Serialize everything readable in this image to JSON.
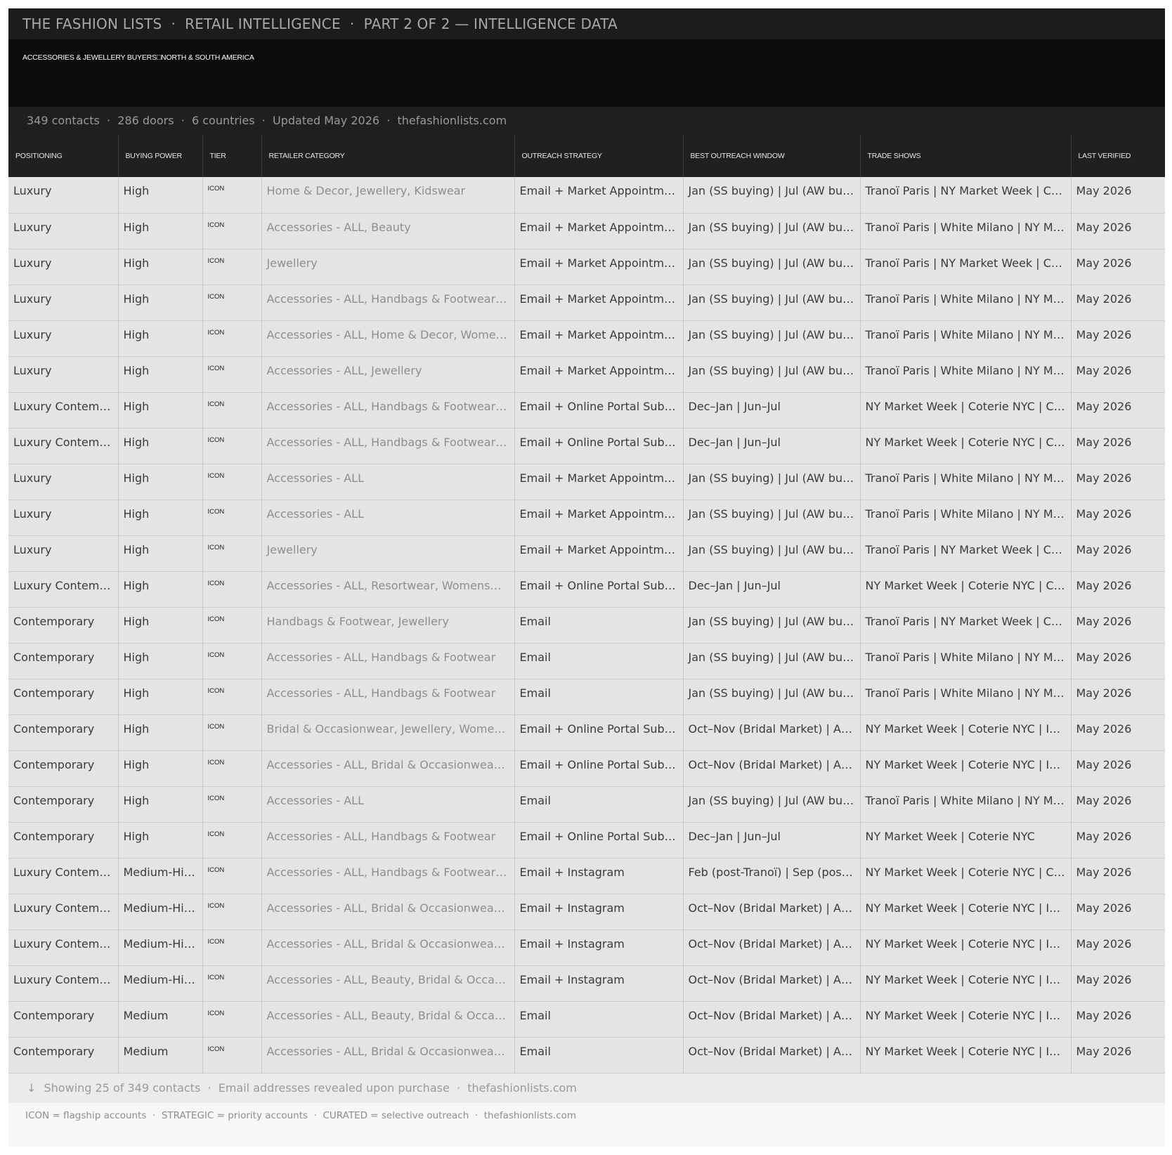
{
  "header": {
    "title": "THE FASHION LISTS  ·  RETAIL INTELLIGENCE  ·  PART 2 OF 2 — INTELLIGENCE DATA",
    "subtitle": "ACCESSORIES & JEWELLERY BUYERS□NORTH & SOUTH AMERICA",
    "stats": "349 contacts  ·  286 doors  ·  6 countries  ·  Updated May 2026  ·  thefashionlists.com"
  },
  "table": {
    "columns": [
      "POSITIONING",
      "BUYING POWER",
      "TIER",
      "RETAILER CATEGORY",
      "OUTREACH STRATEGY",
      "BEST OUTREACH WINDOW",
      "TRADE SHOWS",
      "LAST VERIFIED"
    ],
    "rows": [
      [
        "Luxury",
        "High",
        "ICON",
        "Home & Decor, Jewellery, Kidswear",
        "Email + Market Appointment",
        "Jan (SS buying) | Jul (AW buying)",
        "Tranoï Paris | NY Market Week | Coterie NYC",
        "May 2026"
      ],
      [
        "Luxury",
        "High",
        "ICON",
        "Accessories - ALL, Beauty",
        "Email + Market Appointment",
        "Jan (SS buying) | Jul (AW buying)",
        "Tranoï Paris | White Milano | NY Market Week",
        "May 2026"
      ],
      [
        "Luxury",
        "High",
        "ICON",
        "Jewellery",
        "Email + Market Appointment",
        "Jan (SS buying) | Jul (AW buying)",
        "Tranoï Paris | NY Market Week | Coterie NYC",
        "May 2026"
      ],
      [
        "Luxury",
        "High",
        "ICON",
        "Accessories - ALL, Handbags & Footwear, Jewellery",
        "Email + Market Appointment",
        "Jan (SS buying) | Jul (AW buying)",
        "Tranoï Paris | White Milano | NY Market Week",
        "May 2026"
      ],
      [
        "Luxury",
        "High",
        "ICON",
        "Accessories - ALL, Home & Decor, Womenswear",
        "Email + Market Appointment",
        "Jan (SS buying) | Jul (AW buying)",
        "Tranoï Paris | White Milano | NY Market Week",
        "May 2026"
      ],
      [
        "Luxury",
        "High",
        "ICON",
        "Accessories - ALL, Jewellery",
        "Email + Market Appointment",
        "Jan (SS buying) | Jul (AW buying)",
        "Tranoï Paris | White Milano | NY Market Week",
        "May 2026"
      ],
      [
        "Luxury Contemporary",
        "High",
        "ICON",
        "Accessories - ALL, Handbags & Footwear, Jewellery",
        "Email + Online Portal Submission",
        "Dec–Jan | Jun–Jul",
        "NY Market Week | Coterie NYC | Capsule",
        "May 2026"
      ],
      [
        "Luxury Contemporary",
        "High",
        "ICON",
        "Accessories - ALL, Handbags & Footwear, Jewellery",
        "Email + Online Portal Submission",
        "Dec–Jan | Jun–Jul",
        "NY Market Week | Coterie NYC | Capsule",
        "May 2026"
      ],
      [
        "Luxury",
        "High",
        "ICON",
        "Accessories - ALL",
        "Email + Market Appointment",
        "Jan (SS buying) | Jul (AW buying)",
        "Tranoï Paris | White Milano | NY Market Week",
        "May 2026"
      ],
      [
        "Luxury",
        "High",
        "ICON",
        "Accessories - ALL",
        "Email + Market Appointment",
        "Jan (SS buying) | Jul (AW buying)",
        "Tranoï Paris | White Milano | NY Market Week",
        "May 2026"
      ],
      [
        "Luxury",
        "High",
        "ICON",
        "Jewellery",
        "Email + Market Appointment",
        "Jan (SS buying) | Jul (AW buying)",
        "Tranoï Paris | NY Market Week | Coterie NYC",
        "May 2026"
      ],
      [
        "Luxury Contemporary",
        "High",
        "ICON",
        "Accessories - ALL, Resortwear, Womenswear",
        "Email + Online Portal Submission",
        "Dec–Jan | Jun–Jul",
        "NY Market Week | Coterie NYC | Capsule",
        "May 2026"
      ],
      [
        "Contemporary",
        "High",
        "ICON",
        "Handbags & Footwear, Jewellery",
        "Email",
        "Jan (SS buying) | Jul (AW buying)",
        "Tranoï Paris | NY Market Week | Coterie NYC",
        "May 2026"
      ],
      [
        "Contemporary",
        "High",
        "ICON",
        "Accessories - ALL, Handbags & Footwear",
        "Email",
        "Jan (SS buying) | Jul (AW buying)",
        "Tranoï Paris | White Milano | NY Market Week",
        "May 2026"
      ],
      [
        "Contemporary",
        "High",
        "ICON",
        "Accessories - ALL, Handbags & Footwear",
        "Email",
        "Jan (SS buying) | Jul (AW buying)",
        "Tranoï Paris | White Milano | NY Market Week",
        "May 2026"
      ],
      [
        "Contemporary",
        "High",
        "ICON",
        "Bridal & Occasionwear, Jewellery, Womenswear",
        "Email + Online Portal Submission",
        "Oct–Nov (Bridal Market) | Apr–May",
        "NY Market Week | Coterie NYC | Intermezzo",
        "May 2026"
      ],
      [
        "Contemporary",
        "High",
        "ICON",
        "Accessories - ALL, Bridal & Occasionwear, Jewellery",
        "Email + Online Portal Submission",
        "Oct–Nov (Bridal Market) | Apr–May",
        "NY Market Week | Coterie NYC | Intermezzo",
        "May 2026"
      ],
      [
        "Contemporary",
        "High",
        "ICON",
        "Accessories - ALL",
        "Email",
        "Jan (SS buying) | Jul (AW buying)",
        "Tranoï Paris | White Milano | NY Market Week",
        "May 2026"
      ],
      [
        "Contemporary",
        "High",
        "ICON",
        "Accessories - ALL, Handbags & Footwear",
        "Email + Online Portal Submission",
        "Dec–Jan | Jun–Jul",
        "NY Market Week | Coterie NYC",
        "May 2026"
      ],
      [
        "Luxury Contemporary",
        "Medium-High",
        "ICON",
        "Accessories - ALL, Handbags & Footwear, Jewellery",
        "Email + Instagram",
        "Feb (post-Tranoï) | Sep (post-Tranoï)",
        "NY Market Week | Coterie NYC | Capsule",
        "May 2026"
      ],
      [
        "Luxury Contemporary",
        "Medium-High",
        "ICON",
        "Accessories - ALL, Bridal & Occasionwear, Jewellery",
        "Email + Instagram",
        "Oct–Nov (Bridal Market) | Apr–May",
        "NY Market Week | Coterie NYC | Intermezzo",
        "May 2026"
      ],
      [
        "Luxury Contemporary",
        "Medium-High",
        "ICON",
        "Accessories - ALL, Bridal & Occasionwear, Jewellery",
        "Email + Instagram",
        "Oct–Nov (Bridal Market) | Apr–May",
        "NY Market Week | Coterie NYC | Intermezzo",
        "May 2026"
      ],
      [
        "Luxury Contemporary",
        "Medium-High",
        "ICON",
        "Accessories - ALL, Beauty, Bridal & Occasionwear",
        "Email + Instagram",
        "Oct–Nov (Bridal Market) | Apr–May",
        "NY Market Week | Coterie NYC | Intermezzo",
        "May 2026"
      ],
      [
        "Contemporary",
        "Medium",
        "ICON",
        "Accessories - ALL, Beauty, Bridal & Occasionwear",
        "Email",
        "Oct–Nov (Bridal Market) | Apr–May",
        "NY Market Week | Coterie NYC | Intermezzo",
        "May 2026"
      ],
      [
        "Contemporary",
        "Medium",
        "ICON",
        "Accessories - ALL, Bridal & Occasionwear, Jewellery",
        "Email",
        "Oct–Nov (Bridal Market) | Apr–May",
        "NY Market Week | Coterie NYC | Intermezzo",
        "May 2026"
      ]
    ]
  },
  "footer": {
    "arrow": "↓",
    "showing": "Showing 25 of 349 contacts  ·  Email addresses revealed upon purchase  ·  thefashionlists.com",
    "legend": "ICON = flagship accounts  ·  STRATEGIC = priority accounts  ·  CURATED = selective outreach  ·  thefashionlists.com"
  }
}
